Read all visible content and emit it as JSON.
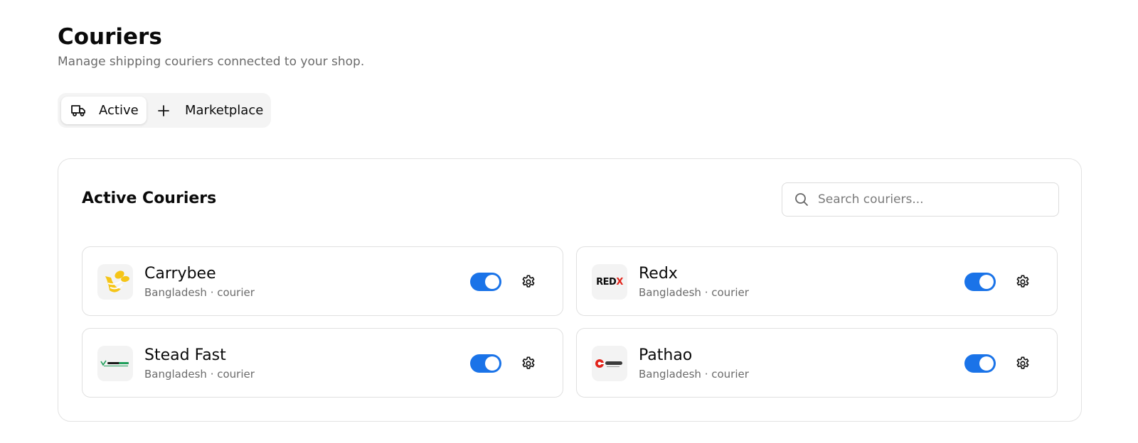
{
  "page": {
    "title": "Couriers",
    "subtitle": "Manage shipping couriers connected to your shop."
  },
  "tabs": [
    {
      "label": "Active",
      "icon": "truck-icon",
      "selected": true
    },
    {
      "label": "Marketplace",
      "icon": "plus-icon",
      "selected": false
    }
  ],
  "panel": {
    "title": "Active Couriers",
    "search": {
      "placeholder": "Search couriers...",
      "value": ""
    }
  },
  "couriers": [
    {
      "name": "Carrybee",
      "meta": "Bangladesh · courier",
      "enabled": true,
      "logo": "carrybee-logo"
    },
    {
      "name": "Redx",
      "meta": "Bangladesh · courier",
      "enabled": true,
      "logo": "redx-logo",
      "logo_text_main": "RED",
      "logo_text_accent": "X"
    },
    {
      "name": "Stead Fast",
      "meta": "Bangladesh · courier",
      "enabled": true,
      "logo": "steadfast-logo"
    },
    {
      "name": "Pathao",
      "meta": "Bangladesh · courier",
      "enabled": true,
      "logo": "pathao-logo"
    }
  ],
  "colors": {
    "accent": "#1a73e8",
    "carrybee": "#f5c518",
    "redx": "#e2231a",
    "pathao": "#e2231a",
    "steadfast": "#1e9e5a"
  }
}
